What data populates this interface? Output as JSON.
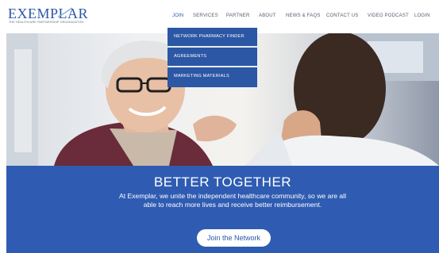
{
  "header": {
    "logo_text": "EXEMPLAR",
    "logo_tagline": "THE HEALTHCARE PARTNERSHIP ORGANIZATION"
  },
  "nav": {
    "items": [
      {
        "label": "JOIN",
        "active": true
      },
      {
        "label": "SERVICES",
        "active": false
      },
      {
        "label": "PARTNER",
        "active": false
      },
      {
        "label": "ABOUT",
        "active": false
      },
      {
        "label": "NEWS & FAQS",
        "active": false
      },
      {
        "label": "CONTACT US",
        "active": false
      },
      {
        "label": "VIDEO PODCAST",
        "active": false
      },
      {
        "label": "LOGIN",
        "active": false
      }
    ]
  },
  "dropdown": {
    "items": [
      {
        "label": "NETWORK PHARMACY FINDER"
      },
      {
        "label": "AGREEMENTS"
      },
      {
        "label": "MARKETING MATERIALS"
      }
    ]
  },
  "band": {
    "title": "BETTER TOGETHER",
    "text": "At Exemplar, we unite the independent healthcare community, so we are all able to reach more lives and receive better reimbursement.",
    "cta_label": "Join the Network"
  },
  "colors": {
    "brand_blue": "#2b57a5",
    "band_blue": "#2f5cb2",
    "nav_text": "#555d6b"
  }
}
